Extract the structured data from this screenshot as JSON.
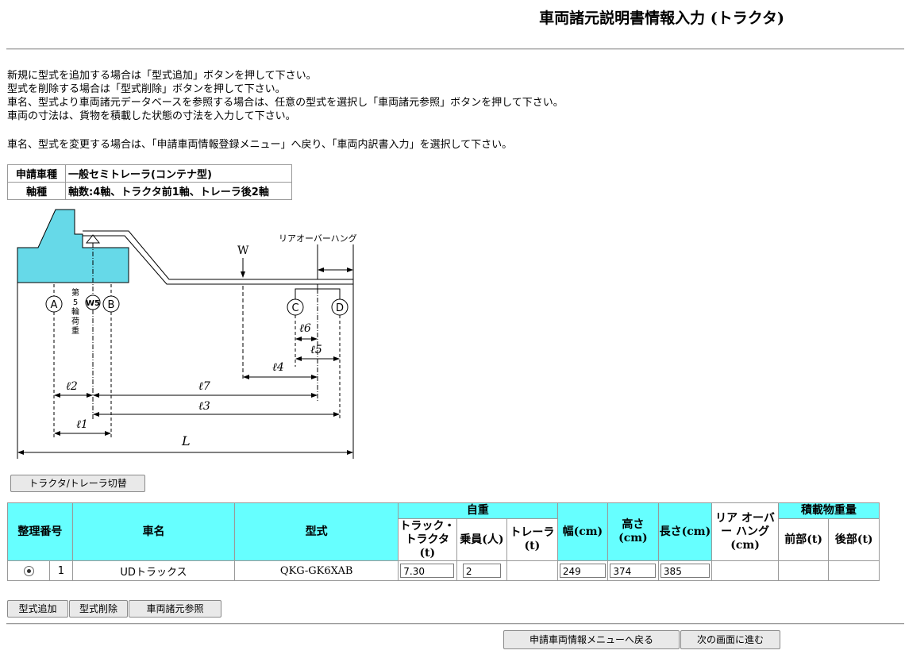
{
  "page": {
    "title": "車両諸元説明書情報入力 (トラクタ)",
    "instructions": [
      "新規に型式を追加する場合は「型式追加」ボタンを押して下さい。",
      "型式を削除する場合は「型式削除」ボタンを押して下さい。",
      "車名、型式より車両諸元データベースを参照する場合は、任意の型式を選択し「車両諸元参照」ボタンを押して下さい。",
      "車両の寸法は、貨物を積載した状態の寸法を入力して下さい。"
    ],
    "instruction2": "車名、型式を変更する場合は、「申請車両情報登録メニュー」へ戻り、「車両内訳書入力」を選択して下さい。"
  },
  "vehicle_info": {
    "type_label": "申請車種",
    "type_value": "一般セミトレーラ(コンテナ型)",
    "axle_label": "軸種",
    "axle_value": "軸数:4軸、トラクタ前1軸、トレーラ後2軸"
  },
  "diagram": {
    "rear_overhang": "リアオーバーハング",
    "w": "W",
    "w5": "W5",
    "fifth_wheel_load": [
      "第",
      "5",
      "輪",
      "荷",
      "重"
    ],
    "axles": [
      "A",
      "B",
      "C",
      "D"
    ],
    "dims": {
      "l1": "ℓ1",
      "l2": "ℓ2",
      "l3": "ℓ3",
      "l4": "ℓ4",
      "l5": "ℓ5",
      "l6": "ℓ6",
      "l7": "ℓ7",
      "L": "L"
    }
  },
  "buttons": {
    "switch": "トラクタ/トレーラ切替",
    "add_model": "型式追加",
    "delete_model": "型式削除",
    "spec_reference": "車両諸元参照",
    "back_menu": "申請車両情報メニューへ戻る",
    "next": "次の画面に進む"
  },
  "table": {
    "headers": {
      "seq": "整理番号",
      "name": "車名",
      "model": "型式",
      "self_weight": "自重",
      "truck_tractor": "トラック・トラクタ (t)",
      "crew": "乗員(人)",
      "trailer": "トレーラ (t)",
      "width": "幅(cm)",
      "height": "高さ(cm)",
      "length": "長さ(cm)",
      "rear_overhang": "リア オーバー ハング (cm)",
      "load_weight": "積載物重量",
      "front": "前部(t)",
      "rear": "後部(t)"
    },
    "rows": [
      {
        "seq": "1",
        "name": "UDトラックス",
        "model": "QKG-GK6XAB",
        "truck_tractor": "7.30",
        "crew": "2",
        "trailer": "",
        "width": "249",
        "height": "374",
        "length": "385",
        "rear_overhang": "",
        "front": "",
        "rear": ""
      }
    ]
  }
}
